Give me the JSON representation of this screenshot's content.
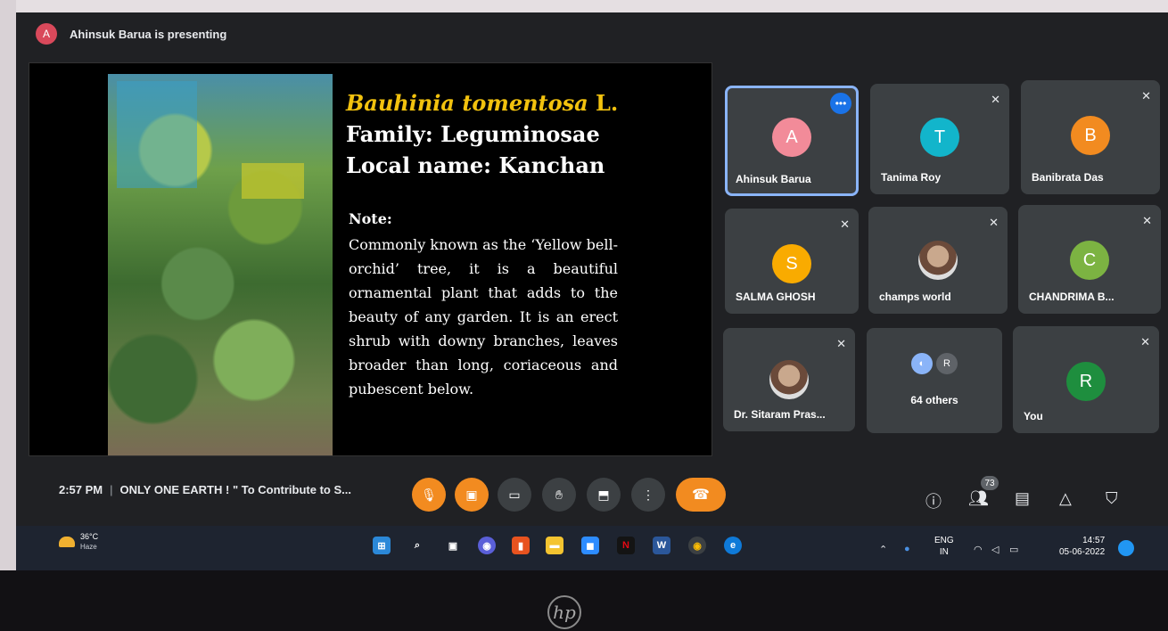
{
  "presenter_bar": {
    "avatar_initial": "A",
    "text": "Ahinsuk Barua is presenting"
  },
  "slide": {
    "sci_name": "Bauhinia tomentosa",
    "sci_author": "L.",
    "family": "Family: Leguminosae",
    "local_name": "Local name: Kanchan",
    "note_heading": "Note:",
    "note_text": "Commonly known as the ‘Yellow bell-orchid’ tree, it is a beautiful ornamental plant that adds to the beauty of any garden. It is an erect shrub with downy branches, leaves broader than long, coriaceous and pubescent below."
  },
  "participants": [
    {
      "initial": "A",
      "name": "Ahinsuk Barua",
      "color": "#f28b99"
    },
    {
      "initial": "T",
      "name": "Tanima Roy",
      "color": "#12b5cb"
    },
    {
      "initial": "B",
      "name": "Banibrata Das",
      "color": "#f28b20"
    },
    {
      "initial": "S",
      "name": "SALMA GHOSH",
      "color": "#f9ab00"
    },
    {
      "initial": "",
      "name": "champs world",
      "color": "#9e7b6b"
    },
    {
      "initial": "C",
      "name": "CHANDRIMA B...",
      "color": "#7cb342"
    },
    {
      "initial": "",
      "name": "Dr. Sitaram Pras...",
      "color": "#9e7b6b"
    },
    {
      "initial": "R",
      "name": "64 others",
      "color": "#5f6368"
    },
    {
      "initial": "R",
      "name": "You",
      "color": "#1e8e3e"
    }
  ],
  "toolbar": {
    "time": "2:57 PM",
    "meeting_title": "ONLY ONE EARTH ! \" To Contribute to S...",
    "people_count": "73",
    "leave_icon": "phone-hangup-icon"
  },
  "taskbar": {
    "temperature": "36°C",
    "weather": "Haze",
    "lang_primary": "ENG",
    "lang_secondary": "IN",
    "time": "14:57",
    "date": "05-06-2022"
  }
}
